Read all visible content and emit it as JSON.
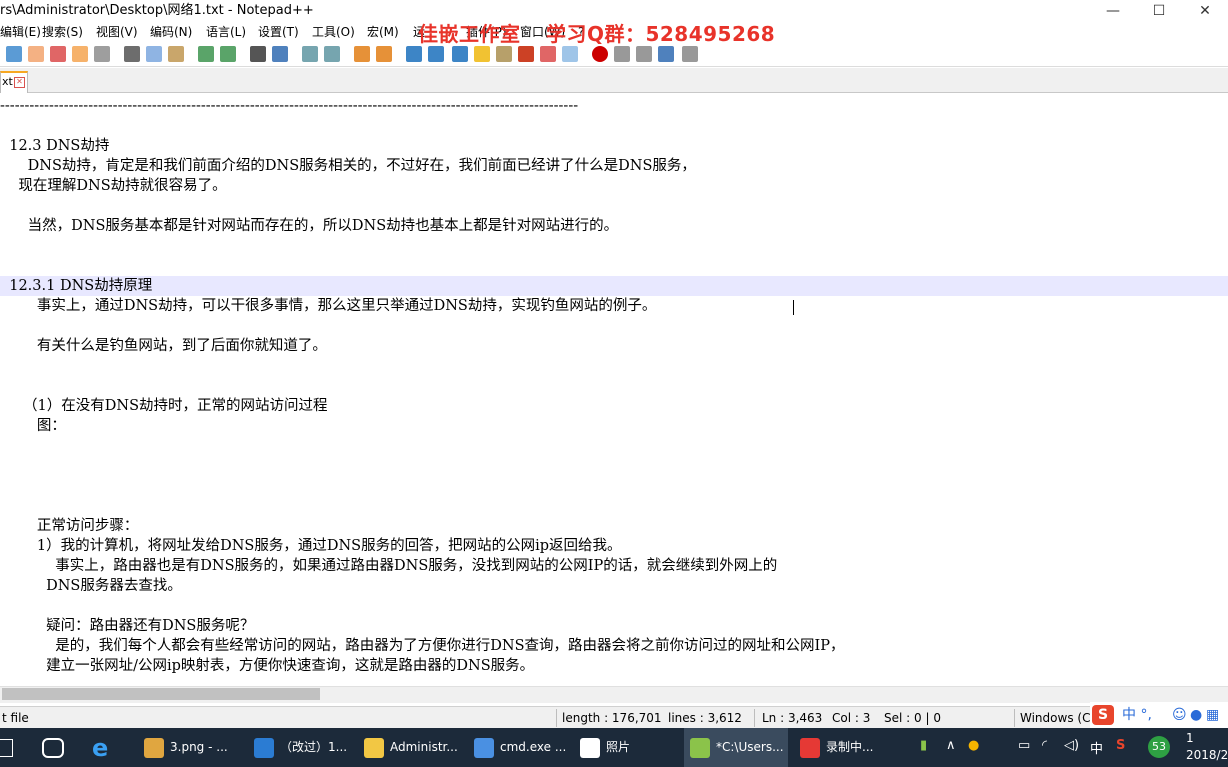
{
  "window": {
    "title": "rs\\Administrator\\Desktop\\网络1.txt - Notepad++",
    "minimize": "—",
    "maximize": "☐",
    "close": "✕"
  },
  "watermark": {
    "studio": "佳嵌工作室",
    "qq": "学习Q群：528495268",
    "color": "#e8332a"
  },
  "menu": {
    "items": [
      "编辑(E)",
      "搜索(S)",
      "视图(V)",
      "编码(N)",
      "语言(L)",
      "设置(T)",
      "工具(O)",
      "宏(M)",
      "运",
      "插件(P)",
      "窗口(W)",
      "?"
    ]
  },
  "toolbar": {
    "icons": [
      "new-icon",
      "open-icon",
      "save-icon",
      "save-all-icon",
      "close-file-icon",
      "print-icon",
      "cut-icon",
      "copy-icon",
      "paste-icon",
      "undo-icon",
      "redo-icon",
      "find-icon",
      "replace-icon",
      "zoom-in-icon",
      "zoom-out-icon",
      "sync-vertical-icon",
      "sync-horizontal-icon",
      "word-wrap-icon",
      "show-all-chars-icon",
      "indent-guide-icon",
      "doc-map-icon",
      "function-list-icon",
      "folder-icon",
      "monitor-icon",
      "record-macro-icon",
      "stop-macro-icon",
      "play-macro-icon",
      "run-macro-multiple-icon",
      "save-macro-icon"
    ]
  },
  "tab": {
    "label": "xt",
    "close": "✕"
  },
  "editor": {
    "lines": [
      "----------------------------------------------------------------------------------------------------------------------",
      "",
      "  12.3 DNS劫持",
      "      DNS劫持，肯定是和我们前面介绍的DNS服务相关的，不过好在，我们前面已经讲了什么是DNS服务，",
      "    现在理解DNS劫持就很容易了。",
      "",
      "      当然，DNS服务基本都是针对网站而存在的，所以DNS劫持也基本上都是针对网站进行的。",
      "",
      "",
      "  12.3.1 DNS劫持原理",
      "        事实上，通过DNS劫持，可以干很多事情，那么这里只举通过DNS劫持，实现钓鱼网站的例子。",
      "",
      "        有关什么是钓鱼网站，到了后面你就知道了。",
      "",
      "",
      "     （1）在没有DNS劫持时，正常的网站访问过程",
      "        图：",
      "",
      "",
      "",
      "",
      "        正常访问步骤：",
      "        1）我的计算机，将网址发给DNS服务，通过DNS服务的回答，把网站的公网ip返回给我。",
      "            事实上，路由器也是有DNS服务的，如果通过路由器DNS服务，没找到网站的公网IP的话，就会继续到外网上的",
      "          DNS服务器去查找。",
      "",
      "          疑问：路由器还有DNS服务呢？",
      "            是的，我们每个人都会有些经常访问的网站，路由器为了方便你进行DNS查询，路由器会将之前你访问过的网址和公网IP，",
      "          建立一张网址/公网ip映射表，方便你快速查询，这就是路由器的DNS服务。"
    ],
    "current_line": 9
  },
  "status": {
    "filetype": "t file",
    "length": "length : 176,701",
    "lines": "lines : 3,612",
    "ln": "Ln : 3,463",
    "col": "Col : 3",
    "sel": "Sel : 0 | 0",
    "eol": "Windows (CR"
  },
  "ime": {
    "label": "中 °,"
  },
  "taskbar": {
    "tasks": [
      {
        "label": "3.png - ...",
        "color": "#e0a640"
      },
      {
        "label": "（改过）1...",
        "color": "#2b7cd3"
      },
      {
        "label": "Administr...",
        "color": "#f2c744"
      },
      {
        "label": "cmd.exe ...",
        "color": "#4a90e2"
      },
      {
        "label": "照片",
        "color": "#ffffff"
      },
      {
        "label": "*C:\\Users...",
        "color": "#8bc34a"
      },
      {
        "label": "录制中...",
        "color": "#e53935"
      }
    ],
    "tray_badge": "53",
    "lang": "中",
    "clock_top": "1",
    "clock_bottom": "2018/2"
  }
}
